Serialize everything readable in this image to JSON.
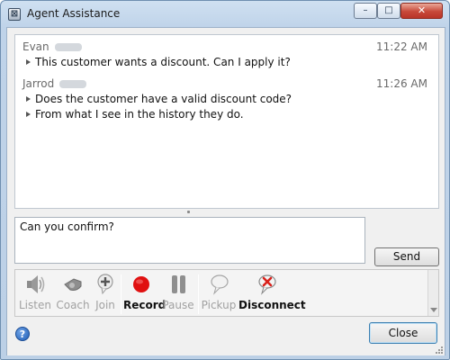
{
  "window": {
    "title": "Agent Assistance",
    "controls": {
      "minimize": "–",
      "maximize": "□",
      "close": "✕"
    }
  },
  "chat": {
    "messages": [
      {
        "sender": "Evan",
        "time": "11:22 AM",
        "lines": [
          "This customer wants a discount.  Can I apply it?"
        ]
      },
      {
        "sender": "Jarrod",
        "time": "11:26 AM",
        "lines": [
          "Does the customer have a valid discount code?",
          "From what I see in the history they do."
        ]
      }
    ]
  },
  "composer": {
    "value": "Can you confirm?",
    "send_label": "Send"
  },
  "toolbar": {
    "items": [
      {
        "label": "Listen",
        "icon": "speaker-icon",
        "enabled": false
      },
      {
        "label": "Coach",
        "icon": "whistle-icon",
        "enabled": false
      },
      {
        "label": "Join",
        "icon": "join-plus-icon",
        "enabled": false
      },
      {
        "label": "Record",
        "icon": "record-icon",
        "enabled": true
      },
      {
        "label": "Pause",
        "icon": "pause-icon",
        "enabled": false
      },
      {
        "label": "Pickup",
        "icon": "pickup-bubble-icon",
        "enabled": false
      },
      {
        "label": "Disconnect",
        "icon": "disconnect-icon",
        "enabled": true
      }
    ]
  },
  "footer": {
    "help_icon": "?",
    "close_label": "Close"
  },
  "colors": {
    "record": "#e01010",
    "disconnect_x": "#d9211b",
    "help": "#1f5db5"
  }
}
